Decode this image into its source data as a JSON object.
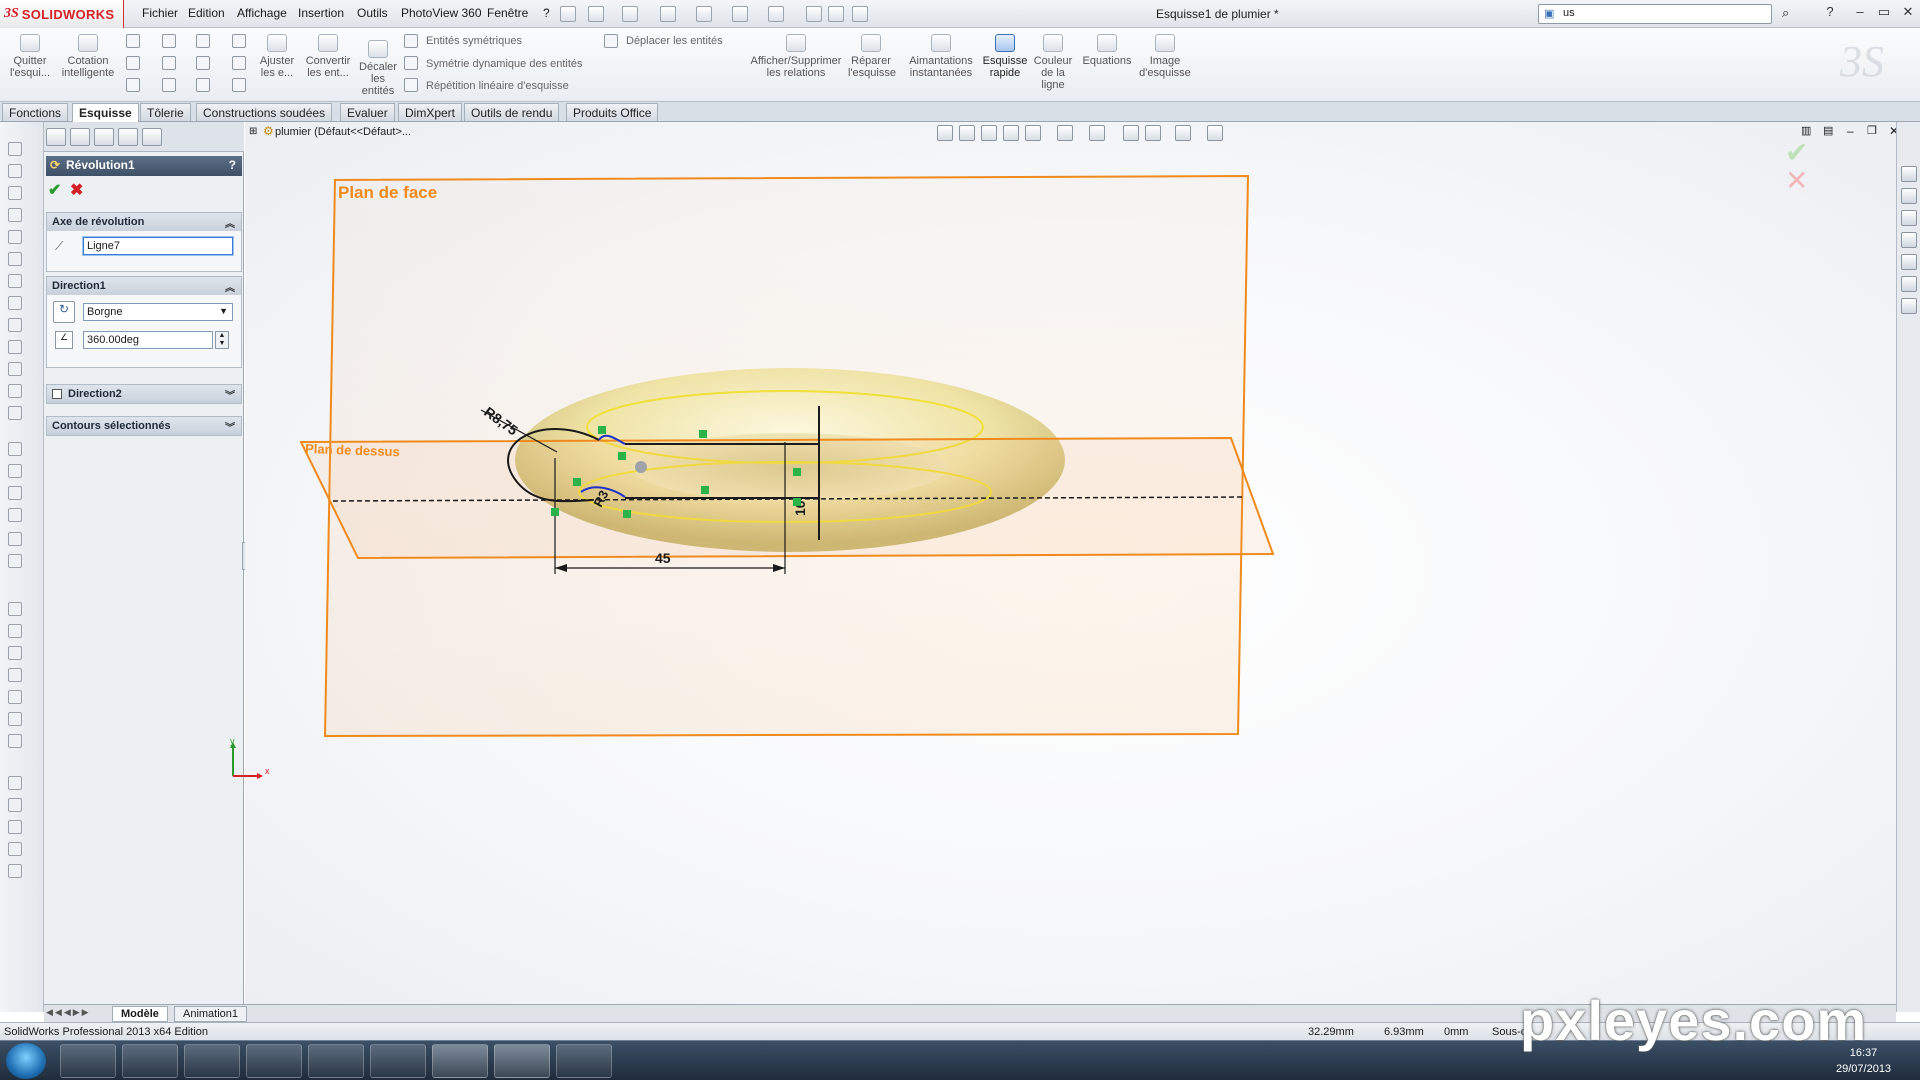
{
  "app": {
    "logo_prefix": "3S",
    "logo_text": "SOLIDWORKS",
    "document_title": "Esquisse1 de plumier *",
    "search_value": "us"
  },
  "menu": [
    "Fichier",
    "Edition",
    "Affichage",
    "Insertion",
    "Outils",
    "PhotoView 360",
    "Fenêtre",
    "?"
  ],
  "window_controls": [
    "?",
    "–",
    "▭",
    "✕"
  ],
  "commands": {
    "quit_sketch": "Quitter l'esqui...",
    "smart_dim": "Cotation intelligente",
    "trim": "Ajuster les e...",
    "convert": "Convertir les ent...",
    "offset": "Décaler les entités",
    "mirror": "Entités symétriques",
    "dyn_mirror": "Symétrie dynamique des entités",
    "linear_pattern": "Répétition linéaire d'esquisse",
    "move": "Déplacer les entités",
    "relations": "Afficher/Supprimer les relations",
    "repair": "Réparer l'esquisse",
    "snaps": "Aimantations instantanées",
    "rapid_sketch": "Esquisse rapide",
    "line_color": "Couleur de la ligne",
    "equations": "Equations",
    "sketch_picture": "Image d'esquisse"
  },
  "tabs": [
    {
      "label": "Fonctions",
      "active": false
    },
    {
      "label": "Esquisse",
      "active": true
    },
    {
      "label": "Tôlerie",
      "active": false
    },
    {
      "label": "Constructions soudées",
      "active": false
    },
    {
      "label": "Evaluer",
      "active": false
    },
    {
      "label": "DimXpert",
      "active": false
    },
    {
      "label": "Outils de rendu",
      "active": false
    },
    {
      "label": "Produits Office",
      "active": false
    }
  ],
  "property_manager": {
    "title": "Révolution1",
    "help": "?",
    "ok": "✔",
    "cancel": "✖",
    "axis_group": {
      "label": "Axe de révolution",
      "value": "Ligne7"
    },
    "direction1": {
      "label": "Direction1",
      "type": "Borgne",
      "angle": "360.00deg"
    },
    "direction2": {
      "label": "Direction2"
    },
    "contours": {
      "label": "Contours sélectionnés"
    }
  },
  "viewport": {
    "feature_path": "plumier  (Défaut<<Défaut>...",
    "plane_front": "Plan de face",
    "plane_top": "Plan de dessus",
    "dims": {
      "r1": "R8,75",
      "r2": "R3",
      "len": "45",
      "v": "10"
    },
    "axes": {
      "x": "x",
      "y": "y"
    }
  },
  "bottom_tabs": [
    "Modèle",
    "Animation1"
  ],
  "status": {
    "edition": "SolidWorks Professional 2013 x64 Edition",
    "x": "32.29mm",
    "y": "6.93mm",
    "z": "0mm",
    "state": "Sous-c"
  },
  "clock": {
    "time": "16:37",
    "date": "29/07/2013"
  },
  "watermark": "pxleyes.com",
  "colors": {
    "plane": "#f08a1c",
    "torus": "#efe3a6",
    "sketch": "#1a1a1a",
    "relation": "#2bb34a",
    "accent": "#d42027"
  }
}
